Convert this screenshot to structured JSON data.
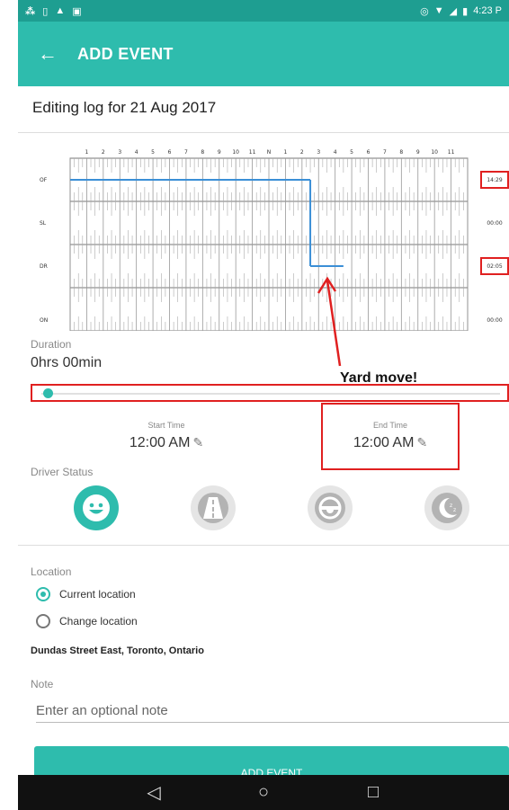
{
  "status_bar": {
    "time": "4:23 P"
  },
  "app_bar": {
    "back_icon": "arrow-left-icon",
    "title": "ADD EVENT"
  },
  "header": {
    "title": "Editing log for 21 Aug 2017"
  },
  "chart_data": {
    "type": "line",
    "x": {
      "label": "",
      "ticks": [
        "1",
        "2",
        "3",
        "4",
        "5",
        "6",
        "7",
        "8",
        "9",
        "10",
        "11",
        "N",
        "1",
        "2",
        "3",
        "4",
        "5",
        "6",
        "7",
        "8",
        "9",
        "10",
        "11"
      ],
      "range": [
        0,
        24
      ]
    },
    "rows": [
      "OF",
      "SL",
      "DR",
      "ON"
    ],
    "totals": [
      "14:29",
      "00:00",
      "02:05",
      "00:00"
    ],
    "series": [
      {
        "status": "OF",
        "start": 0,
        "end": 14.5
      },
      {
        "status": "DR",
        "start": 14.5,
        "end": 16.5
      }
    ],
    "line_color": "#3b8fd6",
    "highlighted_totals": [
      "OF",
      "DR"
    ]
  },
  "duration": {
    "label": "Duration",
    "value": "0hrs 00min",
    "slider_fraction": 0.0
  },
  "annotation": {
    "text": "Yard move!",
    "color": "#e02020"
  },
  "start_time": {
    "label": "Start Time",
    "value": "12:00 AM"
  },
  "end_time": {
    "label": "End Time",
    "value": "12:00 AM"
  },
  "driver_status": {
    "label": "Driver Status",
    "icons": [
      "smiley-icon",
      "road-icon",
      "steering-wheel-icon",
      "moon-sleep-icon"
    ],
    "selected": 0,
    "accent": "#2ebcad"
  },
  "location": {
    "label": "Location",
    "options": [
      "Current location",
      "Change location"
    ],
    "selected": 0,
    "address": "Dundas Street East, Toronto, Ontario"
  },
  "note": {
    "label": "Note",
    "placeholder": "Enter an optional note"
  },
  "add_button": {
    "label": "ADD EVENT"
  },
  "nav": {
    "back_icon": "nav-back-icon",
    "home_icon": "nav-home-icon",
    "recents_icon": "nav-recents-icon"
  }
}
